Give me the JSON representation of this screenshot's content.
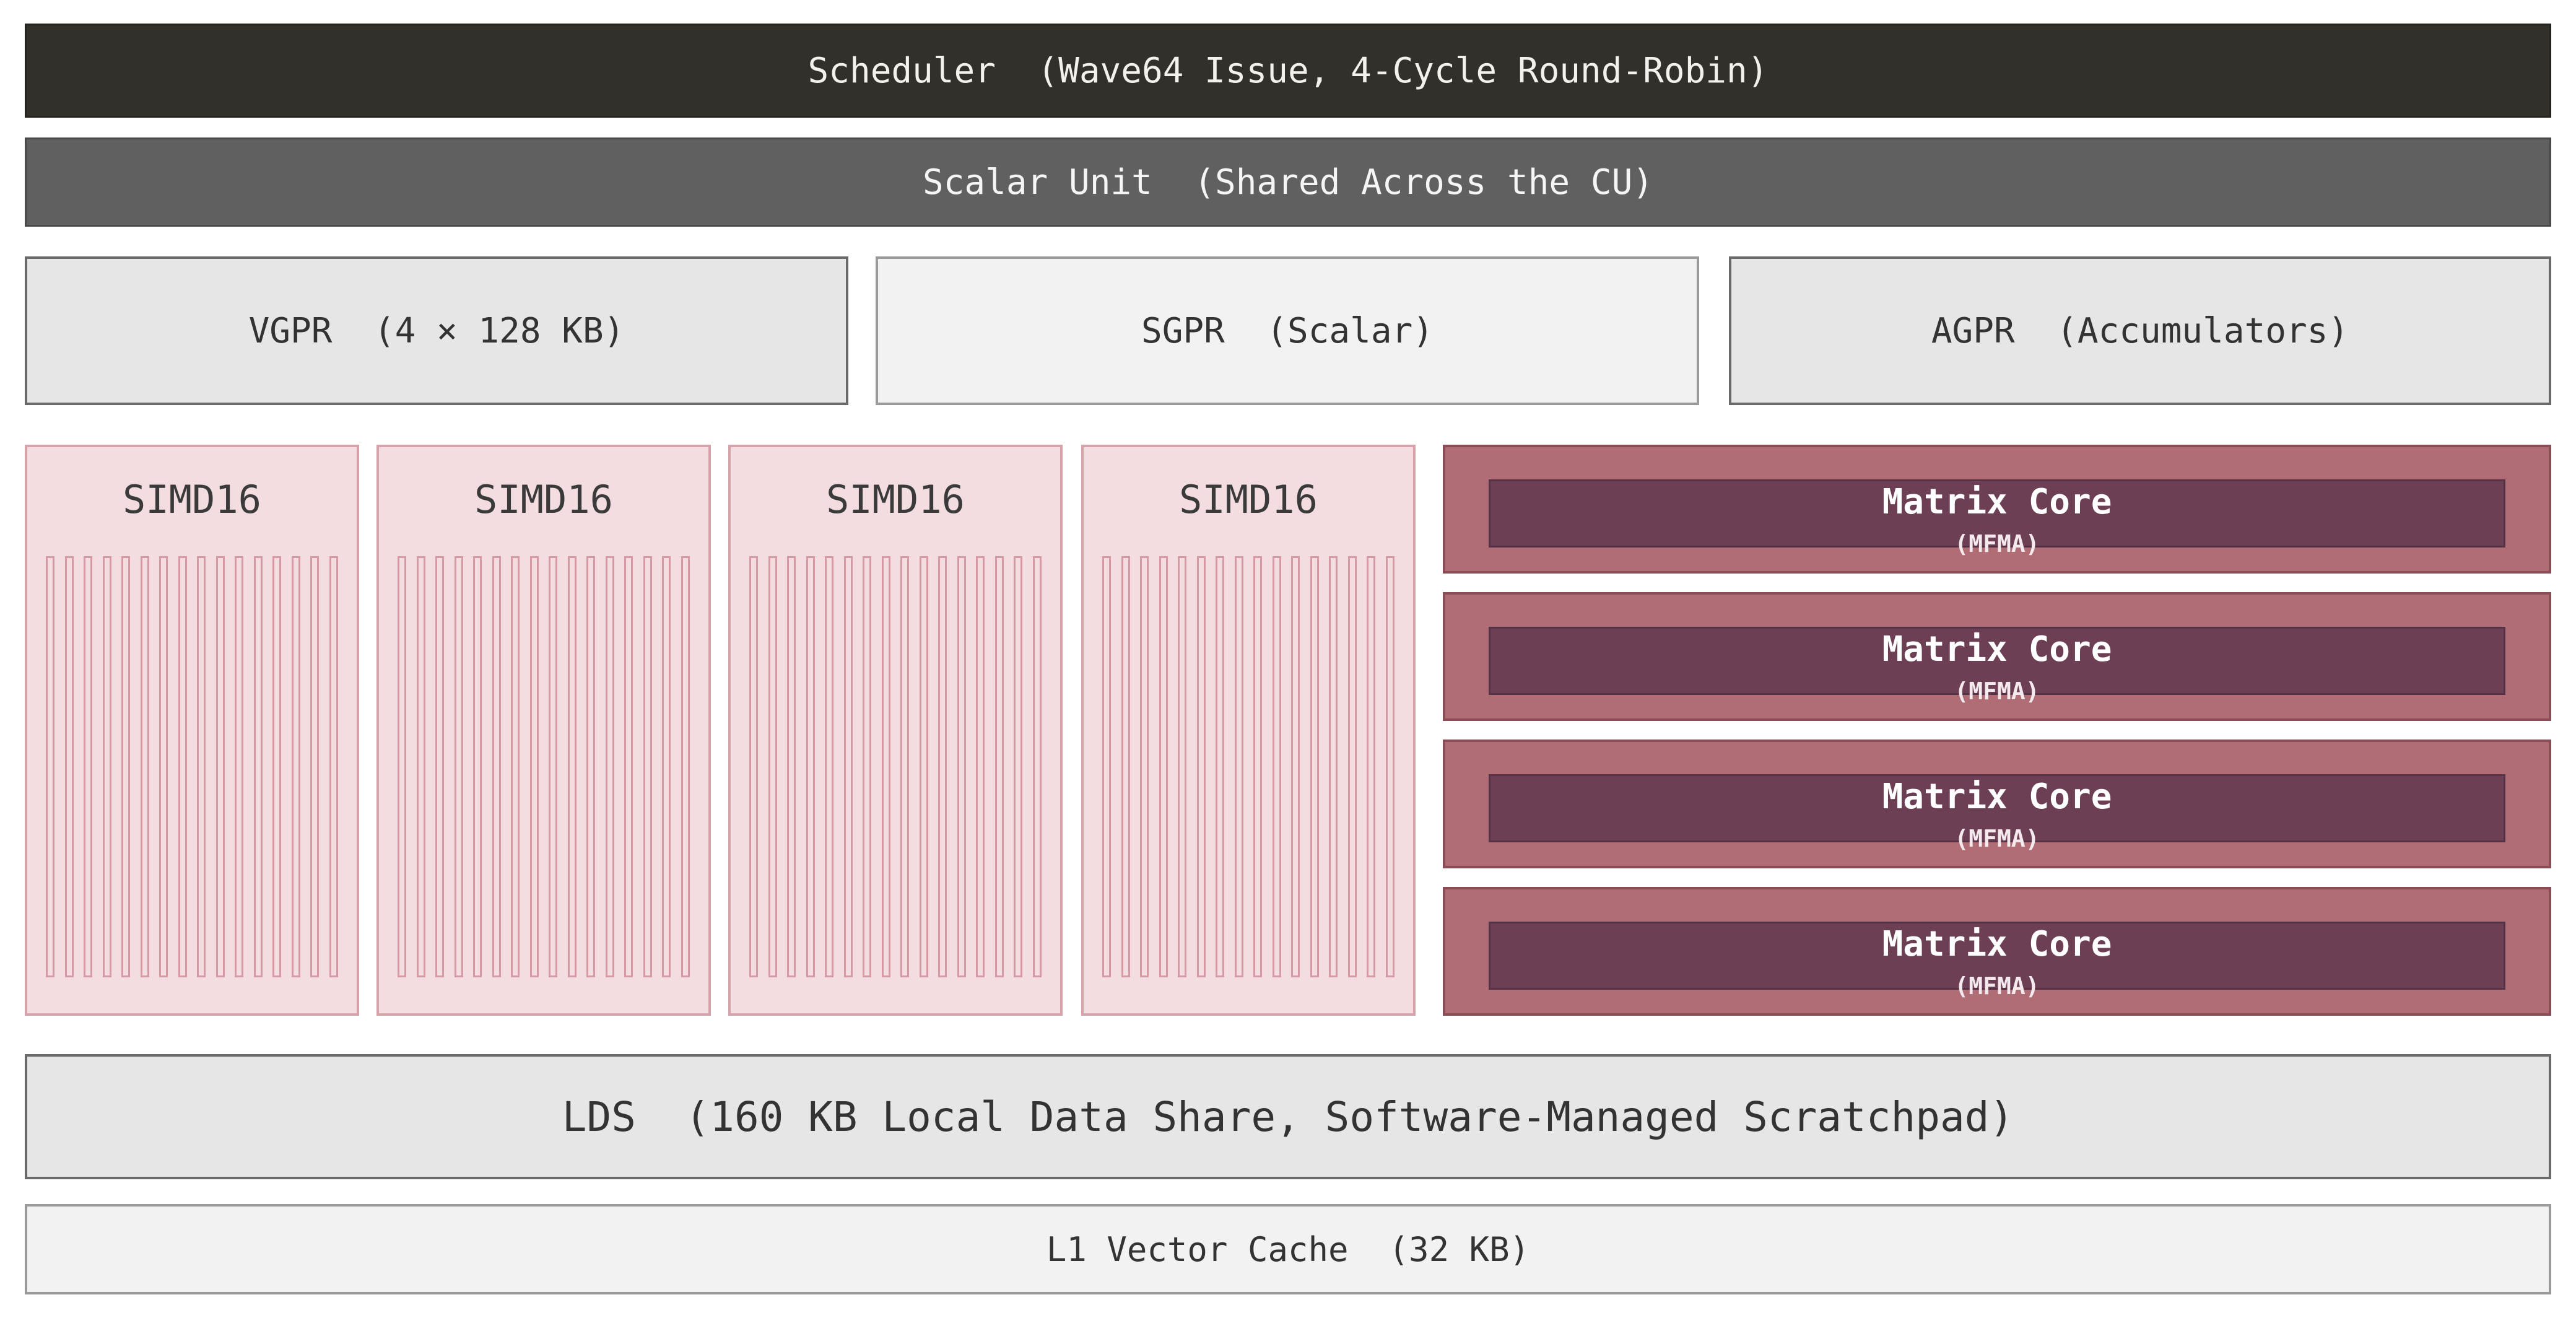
{
  "scheduler": {
    "label": "Scheduler  (Wave64 Issue, 4-Cycle Round-Robin)"
  },
  "scalar_unit": {
    "label": "Scalar Unit  (Shared Across the CU)"
  },
  "registers": [
    {
      "label": "VGPR  (4 × 128 KB)"
    },
    {
      "label": "SGPR  (Scalar)"
    },
    {
      "label": "AGPR  (Accumulators)"
    }
  ],
  "simds": [
    {
      "label": "SIMD16",
      "lanes": 16
    },
    {
      "label": "SIMD16",
      "lanes": 16
    },
    {
      "label": "SIMD16",
      "lanes": 16
    },
    {
      "label": "SIMD16",
      "lanes": 16
    }
  ],
  "matrix_cores": [
    {
      "label": "Matrix Core",
      "sublabel": "(MFMA)"
    },
    {
      "label": "Matrix Core",
      "sublabel": "(MFMA)"
    },
    {
      "label": "Matrix Core",
      "sublabel": "(MFMA)"
    },
    {
      "label": "Matrix Core",
      "sublabel": "(MFMA)"
    }
  ],
  "lds": {
    "label": "LDS  (160 KB Local Data Share, Software-Managed Scratchpad)"
  },
  "l1_cache": {
    "label": "L1 Vector Cache  (32 KB)"
  },
  "colors": {
    "scheduler_bg": "#32302b",
    "scalar_bg": "#606060",
    "simd_bg": "#f3dde0",
    "simd_lane": "#d59aa3",
    "matrix_core_outer": "#b06d75",
    "matrix_core_inner": "#6d3f55"
  }
}
